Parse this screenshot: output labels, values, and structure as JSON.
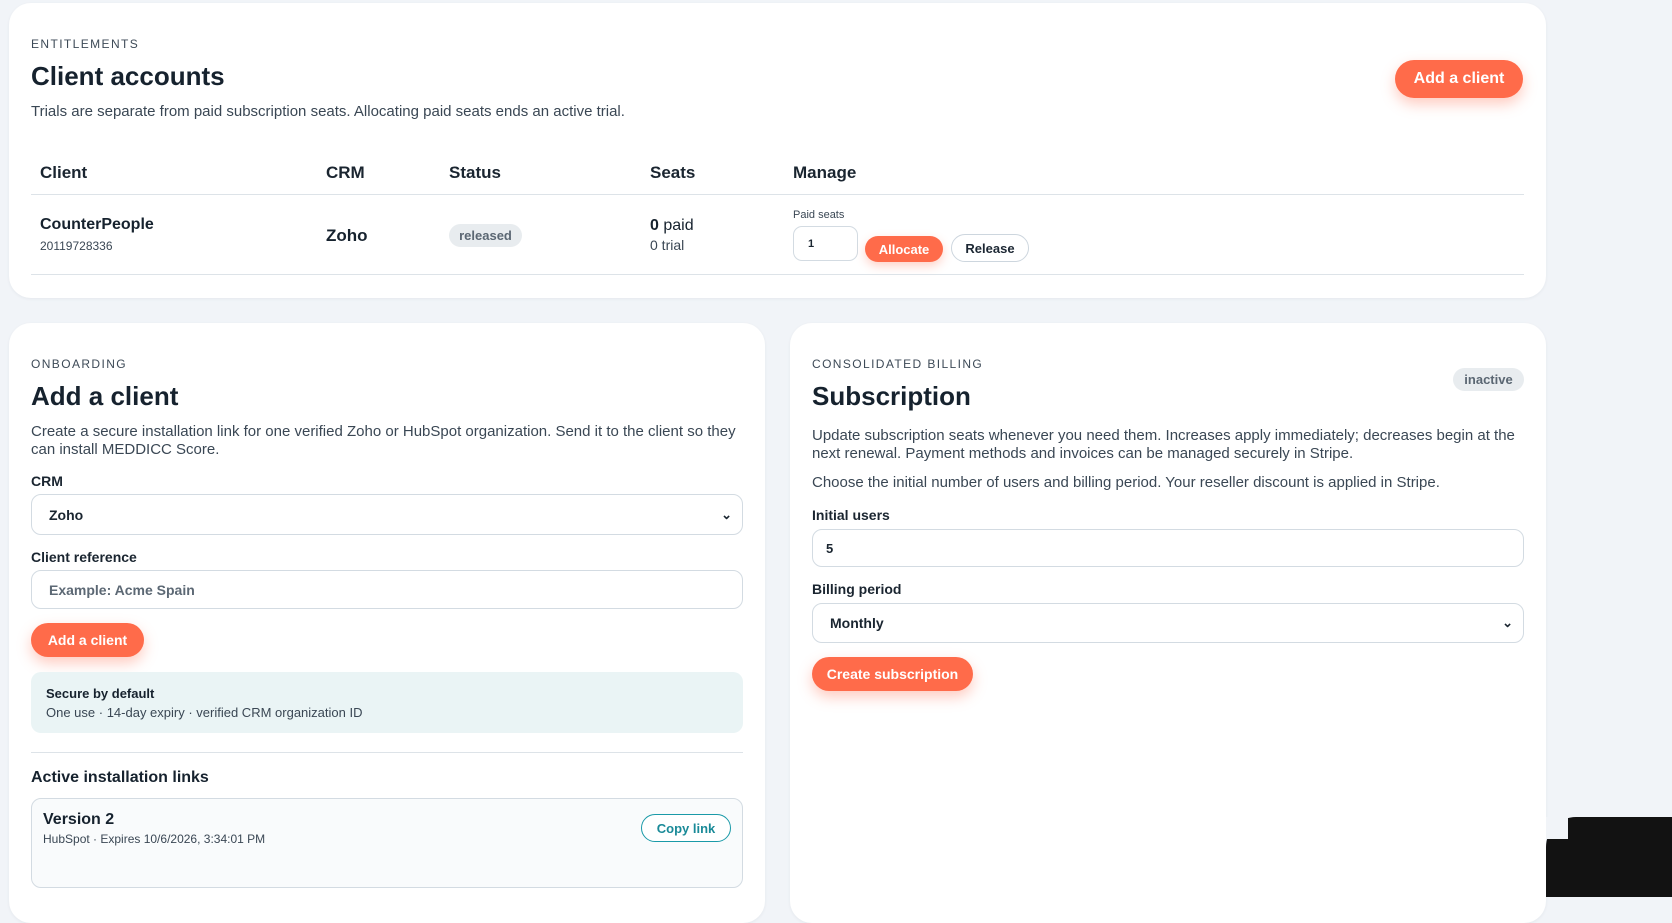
{
  "entitlements": {
    "eyebrow": "ENTITLEMENTS",
    "title": "Client accounts",
    "description": "Trials are separate from paid subscription seats. Allocating paid seats ends an active trial.",
    "add_client_label": "Add a client",
    "table": {
      "headers": [
        "Client",
        "CRM",
        "Status",
        "Seats",
        "Manage"
      ],
      "rows": [
        {
          "client_name": "CounterPeople",
          "client_id": "20119728336",
          "crm": "Zoho",
          "status": "released",
          "seats_paid_count": "0",
          "seats_paid_word": "paid",
          "seats_trial": "0 trial",
          "paid_seats_label": "Paid seats",
          "paid_seats_value": "1",
          "allocate_label": "Allocate",
          "release_label": "Release"
        }
      ]
    }
  },
  "onboarding": {
    "eyebrow": "ONBOARDING",
    "title": "Add a client",
    "description": "Create a secure installation link for one verified Zoho or HubSpot organization. Send it to the client so they can install MEDDICC Score.",
    "crm_label": "CRM",
    "crm_value": "Zoho",
    "client_reference_label": "Client reference",
    "client_reference_placeholder": "Example: Acme Spain",
    "add_client_label": "Add a client",
    "secure_title": "Secure by default",
    "secure_text": "One use · 14-day expiry · verified CRM organization ID",
    "active_links_title": "Active installation links",
    "links": [
      {
        "title": "Version 2",
        "meta": "HubSpot · Expires 10/6/2026, 3:34:01 PM",
        "copy_label": "Copy link"
      }
    ]
  },
  "billing": {
    "eyebrow": "CONSOLIDATED BILLING",
    "title": "Subscription",
    "status": "inactive",
    "description": "Update subscription seats whenever you need them. Increases apply immediately; decreases begin at the next renewal. Payment methods and invoices can be managed securely in Stripe.",
    "description2": "Choose the initial number of users and billing period. Your reseller discount is applied in Stripe.",
    "initial_users_label": "Initial users",
    "initial_users_value": "5",
    "billing_period_label": "Billing period",
    "billing_period_value": "Monthly",
    "create_label": "Create subscription"
  },
  "colors": {
    "accent": "#ff6b4a",
    "teal": "#1a9aa8",
    "background": "#f1f4f8"
  }
}
